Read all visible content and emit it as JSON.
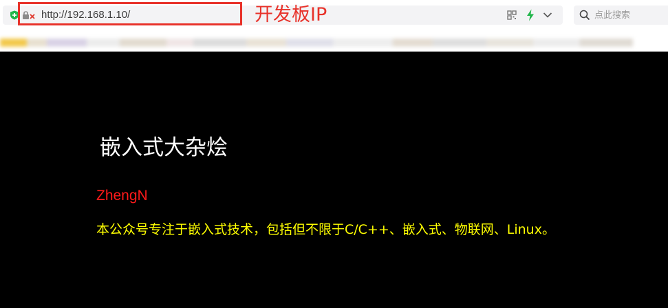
{
  "browser": {
    "url": "http://192.168.1.10/",
    "search_placeholder": "点此搜索"
  },
  "annotation": {
    "label": "开发板IP",
    "color": "#e8322a"
  },
  "page": {
    "title": "嵌入式大杂烩",
    "author": "ZhengN",
    "description": "本公众号专注于嵌入式技术，包括但不限于C/C++、嵌入式、物联网、Linux。",
    "colors": {
      "background": "#000000",
      "title": "#ffffff",
      "author": "#ff1a1a",
      "description": "#ffff00"
    }
  },
  "icons": [
    "shield-icon",
    "insecure-connection-icon",
    "qr-code-icon",
    "lightning-icon",
    "chevron-down-icon",
    "search-icon"
  ]
}
